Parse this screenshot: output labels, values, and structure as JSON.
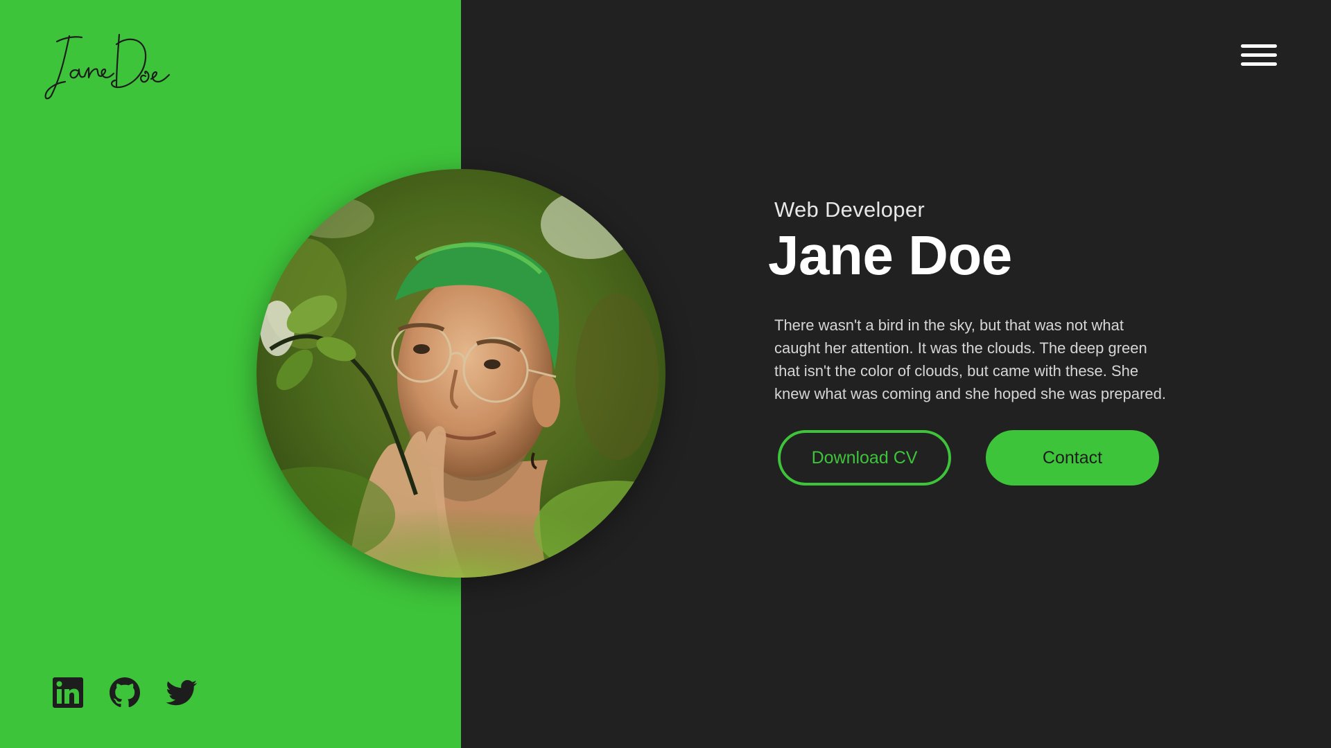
{
  "brand": {
    "logo_text": "Jane Doe"
  },
  "header": {
    "menu_icon": "hamburger-menu-icon"
  },
  "hero": {
    "role": "Web Developer",
    "name": "Jane Doe",
    "bio": "There wasn't a bird in the sky, but that was not what caught her attention. It was the clouds. The deep green that isn't the color of clouds, but came with these. She knew what was coming and she hoped she was prepared.",
    "buttons": {
      "download_cv": "Download CV",
      "contact": "Contact"
    }
  },
  "socials": [
    {
      "icon": "linkedin-icon"
    },
    {
      "icon": "github-icon"
    },
    {
      "icon": "twitter-icon"
    }
  ],
  "colors": {
    "accent": "#3ec43a",
    "background": "#212121",
    "text": "#ffffff",
    "icon_dark": "#1d1d1d"
  }
}
